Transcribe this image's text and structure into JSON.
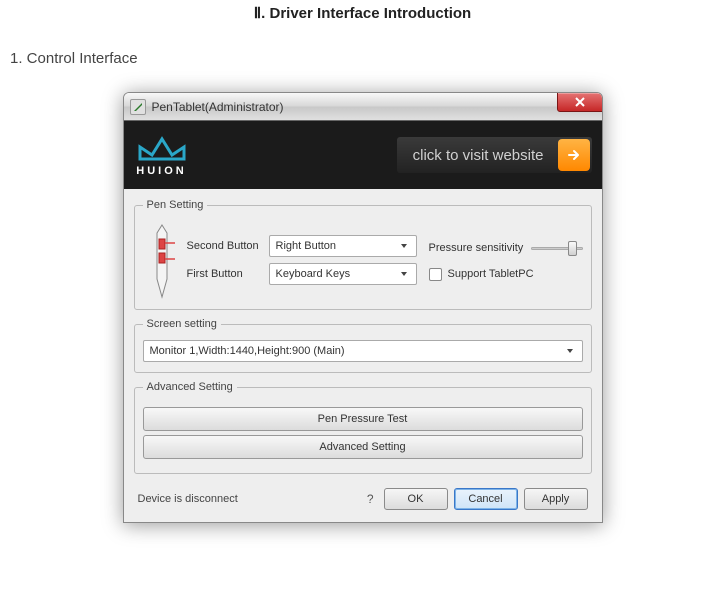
{
  "page_title": "Ⅱ. Driver Interface Introduction",
  "section_heading": "1. Control Interface",
  "titlebar": {
    "text": "PenTablet(Administrator)"
  },
  "banner": {
    "brand": "HUION",
    "link_text": "click to visit website"
  },
  "pen_setting": {
    "legend": "Pen Setting",
    "second_label": "Second Button",
    "second_value": "Right Button",
    "first_label": "First Button",
    "first_value": "Keyboard Keys",
    "pressure_label": "Pressure sensitivity",
    "support_label": "Support TabletPC"
  },
  "screen_setting": {
    "legend": "Screen setting",
    "monitor_value": "Monitor 1,Width:1440,Height:900 (Main)"
  },
  "advanced": {
    "legend": "Advanced Setting",
    "pressure_test": "Pen Pressure Test",
    "advanced_btn": "Advanced Setting"
  },
  "footer": {
    "status": "Device is disconnect",
    "help": "?",
    "ok": "OK",
    "cancel": "Cancel",
    "apply": "Apply"
  }
}
